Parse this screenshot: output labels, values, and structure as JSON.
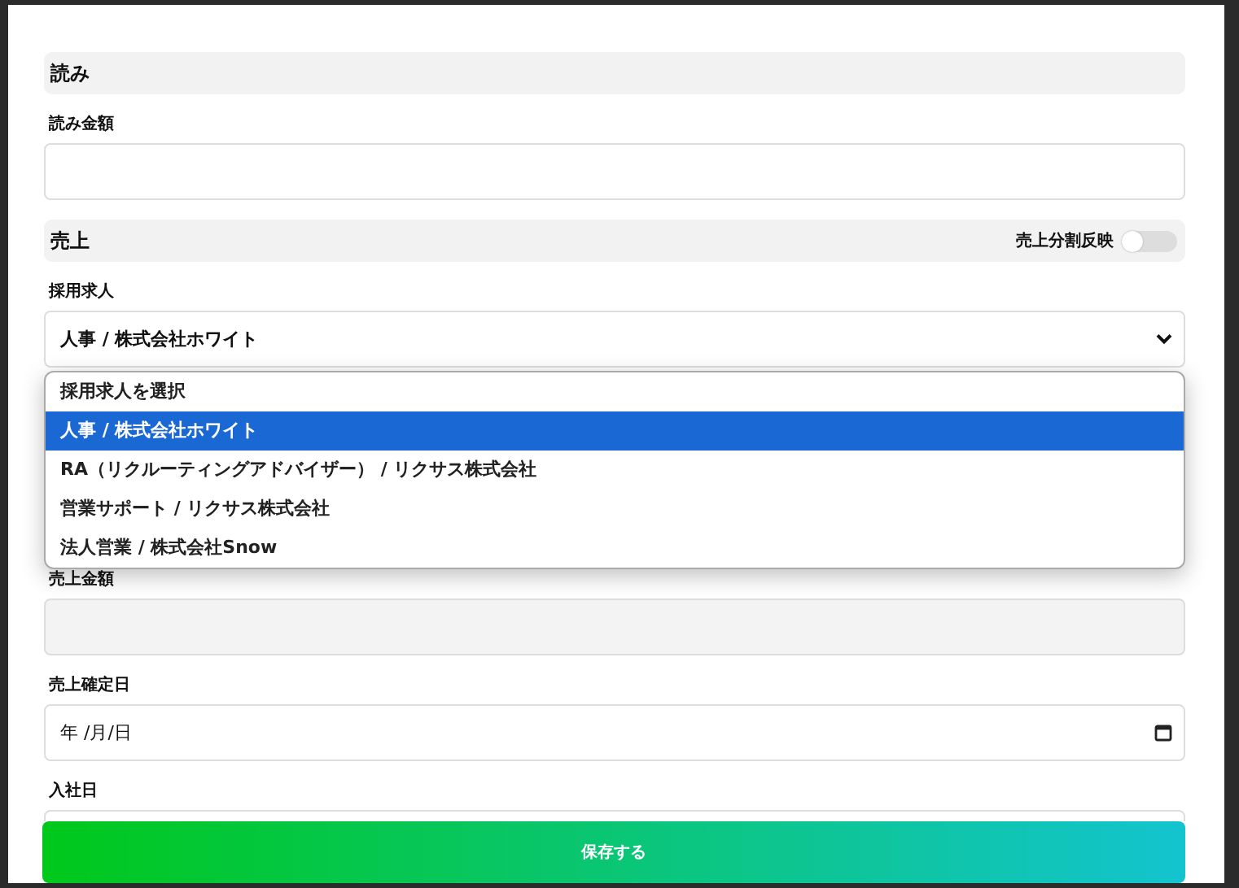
{
  "sections": [
    {
      "title": "読み",
      "fields": [
        {
          "kind": "text",
          "label": "読み金額",
          "disabled": false
        }
      ]
    },
    {
      "title": "売上",
      "toggle": {
        "label": "売上分割反映",
        "on": false
      },
      "fields": [
        {
          "kind": "select",
          "label": "採用求人",
          "value": "人事 / 株式会社ホワイト",
          "expanded": true,
          "options": [
            {
              "label": "採用求人を選択",
              "selected": false
            },
            {
              "label": "人事 / 株式会社ホワイト",
              "selected": true
            },
            {
              "label": "RA（リクルーティングアドバイザー） / リクサス株式会社",
              "selected": false
            },
            {
              "label": "営業サポート / リクサス株式会社",
              "selected": false
            },
            {
              "label": "法人営業 / 株式会社Snow",
              "selected": false
            }
          ]
        },
        {
          "kind": "text",
          "label": "売上金額",
          "disabled": true
        },
        {
          "kind": "date",
          "label": "売上確定日",
          "placeholder": "年 /月/日"
        },
        {
          "kind": "text",
          "label": "入社日",
          "disabled": false
        }
      ]
    }
  ],
  "save_button": {
    "label": "保存する"
  }
}
